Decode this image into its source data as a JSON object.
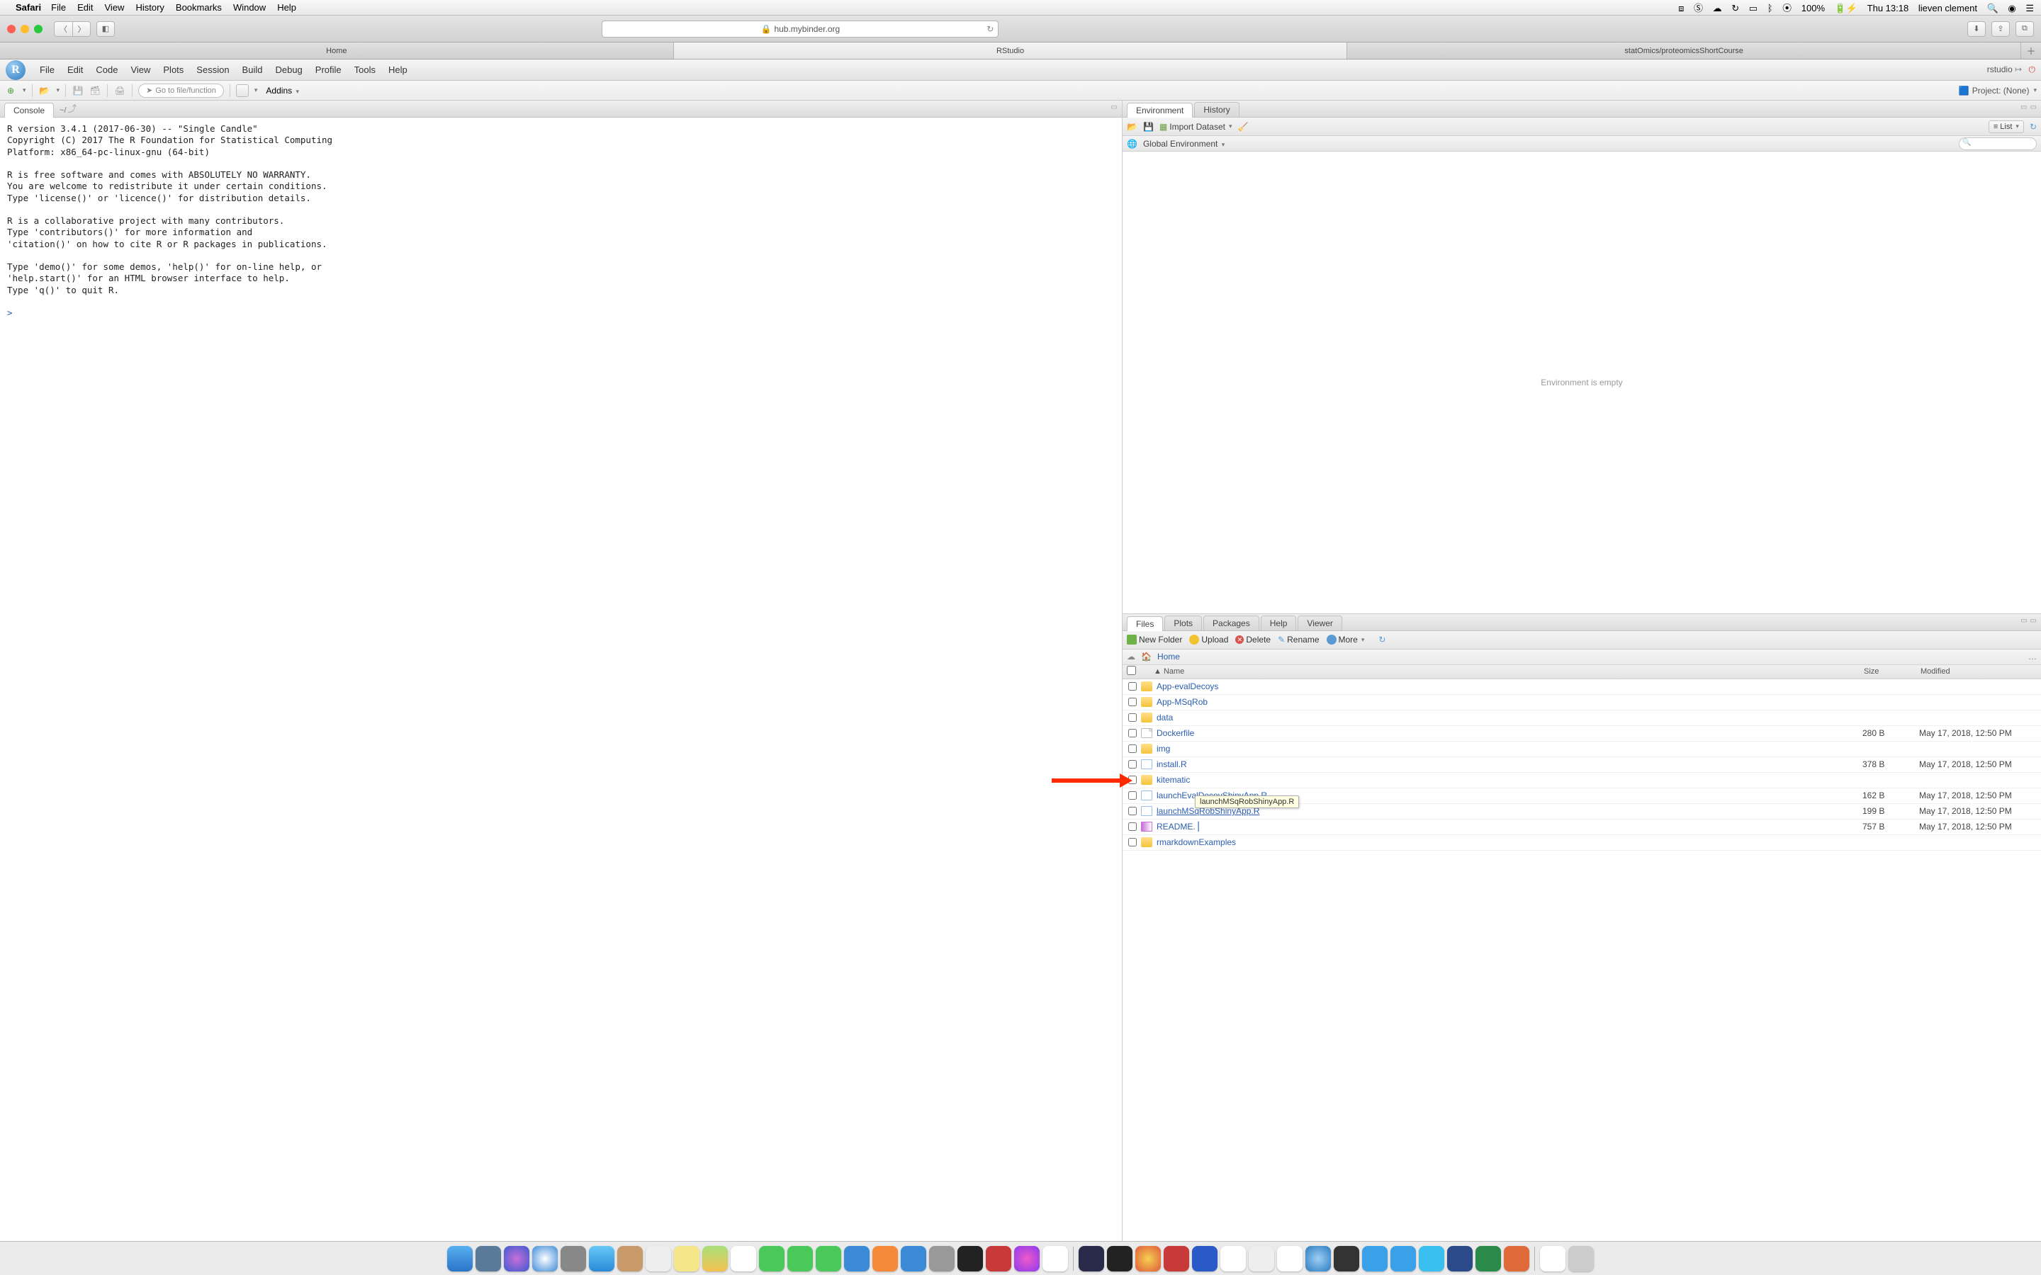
{
  "mac_menu": {
    "app": "Safari",
    "items": [
      "File",
      "Edit",
      "View",
      "History",
      "Bookmarks",
      "Window",
      "Help"
    ],
    "battery": "100%",
    "clock": "Thu 13:18",
    "user": "lieven clement"
  },
  "safari": {
    "url": "hub.mybinder.org",
    "tabs": [
      "Home",
      "RStudio",
      "statOmics/proteomicsShortCourse"
    ],
    "active_tab": 1
  },
  "rstudio_menu": [
    "File",
    "Edit",
    "Code",
    "View",
    "Plots",
    "Session",
    "Build",
    "Debug",
    "Profile",
    "Tools",
    "Help"
  ],
  "rstudio_user": "rstudio",
  "goto_placeholder": "Go to file/function",
  "addins": "Addins",
  "project": "Project: (None)",
  "console": {
    "title": "Console",
    "path": "~/",
    "text": "R version 3.4.1 (2017-06-30) -- \"Single Candle\"\nCopyright (C) 2017 The R Foundation for Statistical Computing\nPlatform: x86_64-pc-linux-gnu (64-bit)\n\nR is free software and comes with ABSOLUTELY NO WARRANTY.\nYou are welcome to redistribute it under certain conditions.\nType 'license()' or 'licence()' for distribution details.\n\nR is a collaborative project with many contributors.\nType 'contributors()' for more information and\n'citation()' on how to cite R or R packages in publications.\n\nType 'demo()' for some demos, 'help()' for on-line help, or\n'help.start()' for an HTML browser interface to help.\nType 'q()' to quit R.\n",
    "prompt": ">"
  },
  "env_tabs": [
    "Environment",
    "History"
  ],
  "env_toolbar": {
    "import": "Import Dataset",
    "list": "List",
    "scope": "Global Environment"
  },
  "env_empty": "Environment is empty",
  "files_tabs": [
    "Files",
    "Plots",
    "Packages",
    "Help",
    "Viewer"
  ],
  "files_toolbar": {
    "new": "New Folder",
    "upload": "Upload",
    "delete": "Delete",
    "rename": "Rename",
    "more": "More"
  },
  "breadcrumb_home": "Home",
  "file_cols": {
    "name": "Name",
    "size": "Size",
    "modified": "Modified"
  },
  "files": [
    {
      "type": "folder",
      "name": "App-evalDecoys",
      "size": "",
      "mod": ""
    },
    {
      "type": "folder",
      "name": "App-MSqRob",
      "size": "",
      "mod": ""
    },
    {
      "type": "folder",
      "name": "data",
      "size": "",
      "mod": ""
    },
    {
      "type": "file",
      "name": "Dockerfile",
      "size": "280 B",
      "mod": "May 17, 2018, 12:50 PM"
    },
    {
      "type": "folder",
      "name": "img",
      "size": "",
      "mod": ""
    },
    {
      "type": "r",
      "name": "install.R",
      "size": "378 B",
      "mod": "May 17, 2018, 12:50 PM"
    },
    {
      "type": "folder",
      "name": "kitematic",
      "size": "",
      "mod": ""
    },
    {
      "type": "r",
      "name": "launchEvalDecoyShinyApp.R",
      "size": "162 B",
      "mod": "May 17, 2018, 12:50 PM"
    },
    {
      "type": "r",
      "name": "launchMSqRobShinyApp.R",
      "size": "199 B",
      "mod": "May 17, 2018, 12:50 PM",
      "hl": true
    },
    {
      "type": "md",
      "name": "README.md",
      "trunc": "README.⎪",
      "size": "757 B",
      "mod": "May 17, 2018, 12:50 PM"
    },
    {
      "type": "folder",
      "name": "rmarkdownExamples",
      "size": "",
      "mod": ""
    }
  ],
  "tooltip": "launchMSqRobShinyApp.R"
}
